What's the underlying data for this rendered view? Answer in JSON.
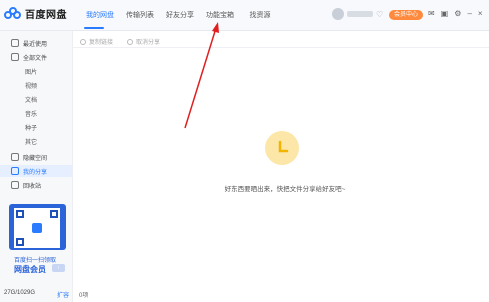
{
  "app": {
    "title": "百度网盘"
  },
  "nav": {
    "tabs": [
      "我的网盘",
      "传输列表",
      "好友分享",
      "功能宝箱",
      "找资源"
    ]
  },
  "header": {
    "vip_label": "会员中心"
  },
  "sidebar": {
    "items": [
      {
        "label": "最近使用"
      },
      {
        "label": "全部文件"
      },
      {
        "label": "图片"
      },
      {
        "label": "视频"
      },
      {
        "label": "文档"
      },
      {
        "label": "音乐"
      },
      {
        "label": "种子"
      },
      {
        "label": "其它"
      },
      {
        "label": "隐藏空间"
      },
      {
        "label": "我的分享"
      },
      {
        "label": "回收站"
      }
    ],
    "promo_line1": "百度扫一扫领取",
    "promo_line2": "网盘会员",
    "storage": "27G/1029G",
    "expand_label": "扩容"
  },
  "toolbar": {
    "copy_link": "复制链接",
    "cancel_share": "取消分享"
  },
  "main": {
    "empty_text": "好东西要晒出来，快把文件分享给好友吧~",
    "count": "0项"
  },
  "colors": {
    "accent": "#2b7bff",
    "vip": "#ff8a3d",
    "annotation": "#e02020"
  }
}
